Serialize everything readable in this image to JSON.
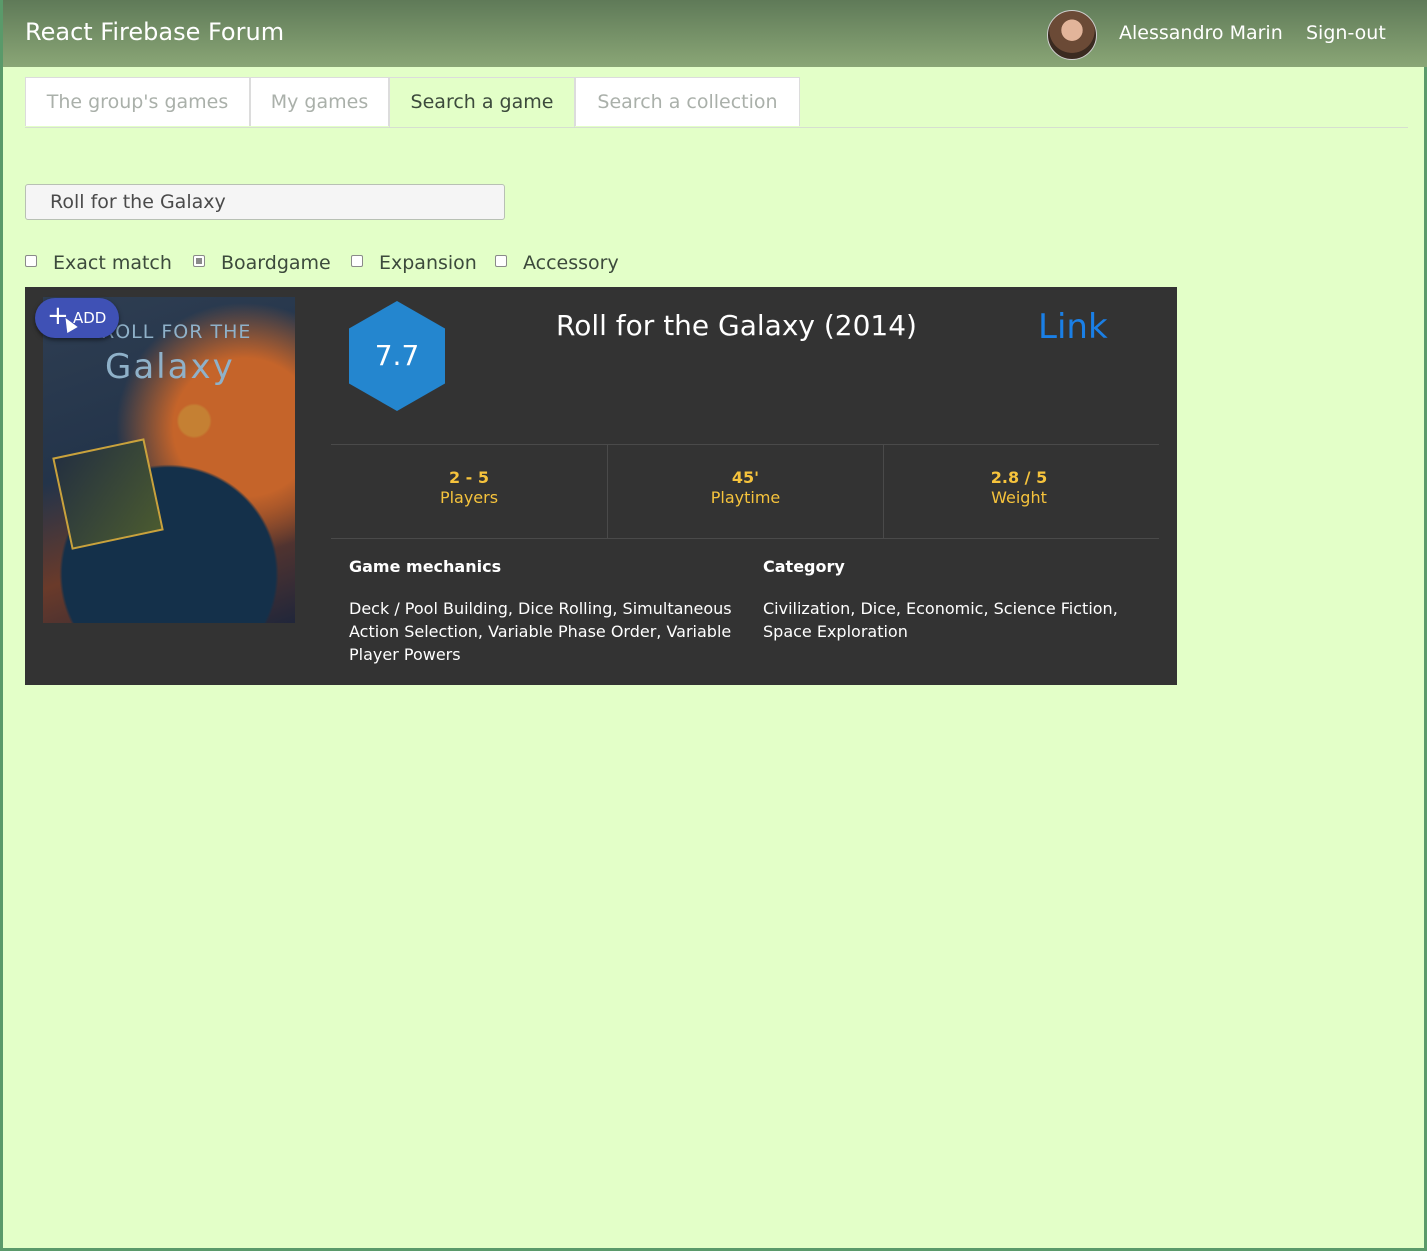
{
  "app": {
    "title": "React Firebase Forum",
    "user_name": "Alessandro Marin",
    "sign_out_label": "Sign-out"
  },
  "tabs": [
    {
      "label": "The group's games",
      "active": false
    },
    {
      "label": "My games",
      "active": false
    },
    {
      "label": "Search a game",
      "active": true
    },
    {
      "label": "Search a collection",
      "active": false
    }
  ],
  "search": {
    "value": "Roll for the Galaxy"
  },
  "filters": [
    {
      "label": "Exact match",
      "checked": false
    },
    {
      "label": "Boardgame",
      "checked": true
    },
    {
      "label": "Expansion",
      "checked": false
    },
    {
      "label": "Accessory",
      "checked": false
    }
  ],
  "result": {
    "add_label": "ADD",
    "add_icon": "plus-icon",
    "cover_text_line1": "ROLL FOR THE",
    "cover_text_line2": "Galaxy",
    "rating": "7.7",
    "title": "Roll for the Galaxy (2014)",
    "link_label": "Link",
    "stats": [
      {
        "value": "2 - 5",
        "label": "Players"
      },
      {
        "value": "45'",
        "label": "Playtime"
      },
      {
        "value": "2.8 / 5",
        "label": "Weight"
      }
    ],
    "mechanics_heading": "Game mechanics",
    "mechanics_text": "Deck / Pool Building, Dice Rolling, Simultaneous Action Selection, Variable Phase Order, Variable Player Powers",
    "category_heading": "Category",
    "category_text": "Civilization, Dice, Economic, Science Fiction, Space Exploration"
  },
  "colors": {
    "background": "#e3ffc8",
    "navbar": "#7a9468",
    "card": "#333333",
    "rating_hex": "#2486cf",
    "stat_text": "#f6c33c",
    "link": "#1a7fe6",
    "add_button": "#3f51b5"
  }
}
